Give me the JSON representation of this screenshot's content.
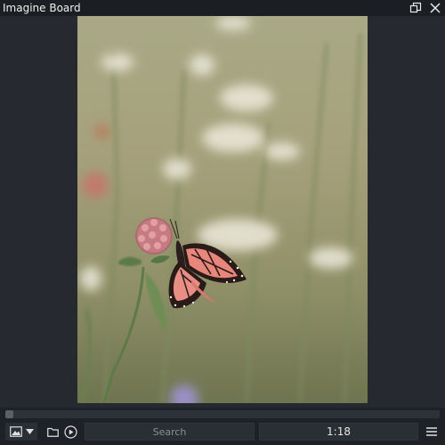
{
  "window": {
    "title": "Imagine Board",
    "restore_icon": "restore-window-icon",
    "close_icon": "close-icon"
  },
  "viewer": {
    "image_description_icon": "butterfly-on-clover-photo"
  },
  "toolbar": {
    "seek_position": 0,
    "view_mode_icon": "image-icon",
    "dropdown_icon": "chevron-down-icon",
    "folder_icon": "folder-icon",
    "play_icon": "play-icon",
    "search_placeholder": "Search",
    "counter": "1:18",
    "menu_icon": "hamburger-menu-icon"
  },
  "colors": {
    "background": "#20242a",
    "titlebar": "#1b1e22",
    "panel": "#1e2126"
  }
}
